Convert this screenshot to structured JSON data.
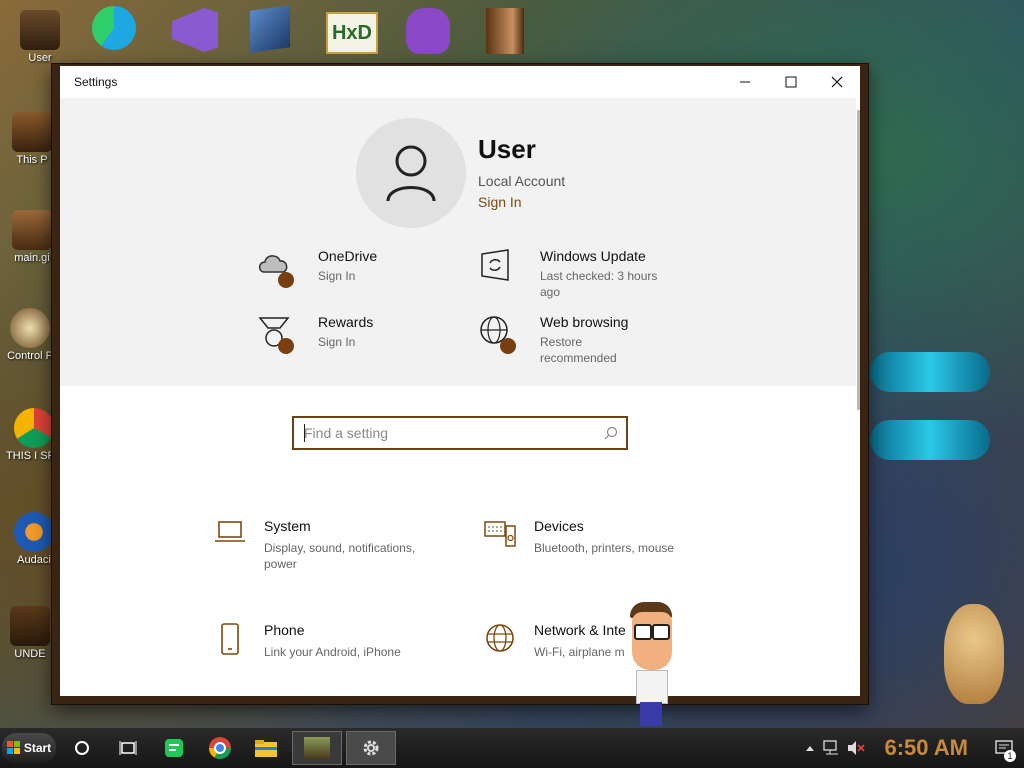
{
  "desktop": {
    "icons": [
      {
        "label": "User"
      },
      {
        "label": "This P"
      },
      {
        "label": "main.gi"
      },
      {
        "label": "Control P"
      },
      {
        "label": "THIS I SPYWA"
      },
      {
        "label": "Audaci"
      },
      {
        "label": "UNDE"
      }
    ]
  },
  "window": {
    "title": "Settings",
    "minimize_glyph": "—",
    "maximize_glyph": "☐",
    "close_glyph": "✕"
  },
  "account": {
    "name": "User",
    "type": "Local Account",
    "sign_in": "Sign In"
  },
  "quick_tiles": [
    {
      "title": "OneDrive",
      "subtitle": "Sign In",
      "icon": "cloud-icon"
    },
    {
      "title": "Windows Update",
      "subtitle": "Last checked: 3 hours ago",
      "icon": "update-icon"
    },
    {
      "title": "Rewards",
      "subtitle": "Sign In",
      "icon": "medal-icon"
    },
    {
      "title": "Web browsing",
      "subtitle": "Restore recommended",
      "icon": "globe-icon"
    }
  ],
  "search": {
    "placeholder": "Find a setting"
  },
  "categories": [
    {
      "title": "System",
      "subtitle": "Display, sound, notifications, power",
      "icon": "laptop-icon"
    },
    {
      "title": "Devices",
      "subtitle": "Bluetooth, printers, mouse",
      "icon": "keyboard-icon"
    },
    {
      "title": "Phone",
      "subtitle": "Link your Android, iPhone",
      "icon": "phone-icon"
    },
    {
      "title": "Network & Inte",
      "subtitle": "Wi-Fi, airplane m",
      "icon": "globe-icon"
    }
  ],
  "taskbar": {
    "start_label": "Start",
    "clock": "6:50 AM",
    "notification_count": "1"
  },
  "colors": {
    "accent": "#7a4a10",
    "dot": "#7a3f10",
    "clock": "#c88a3a"
  }
}
